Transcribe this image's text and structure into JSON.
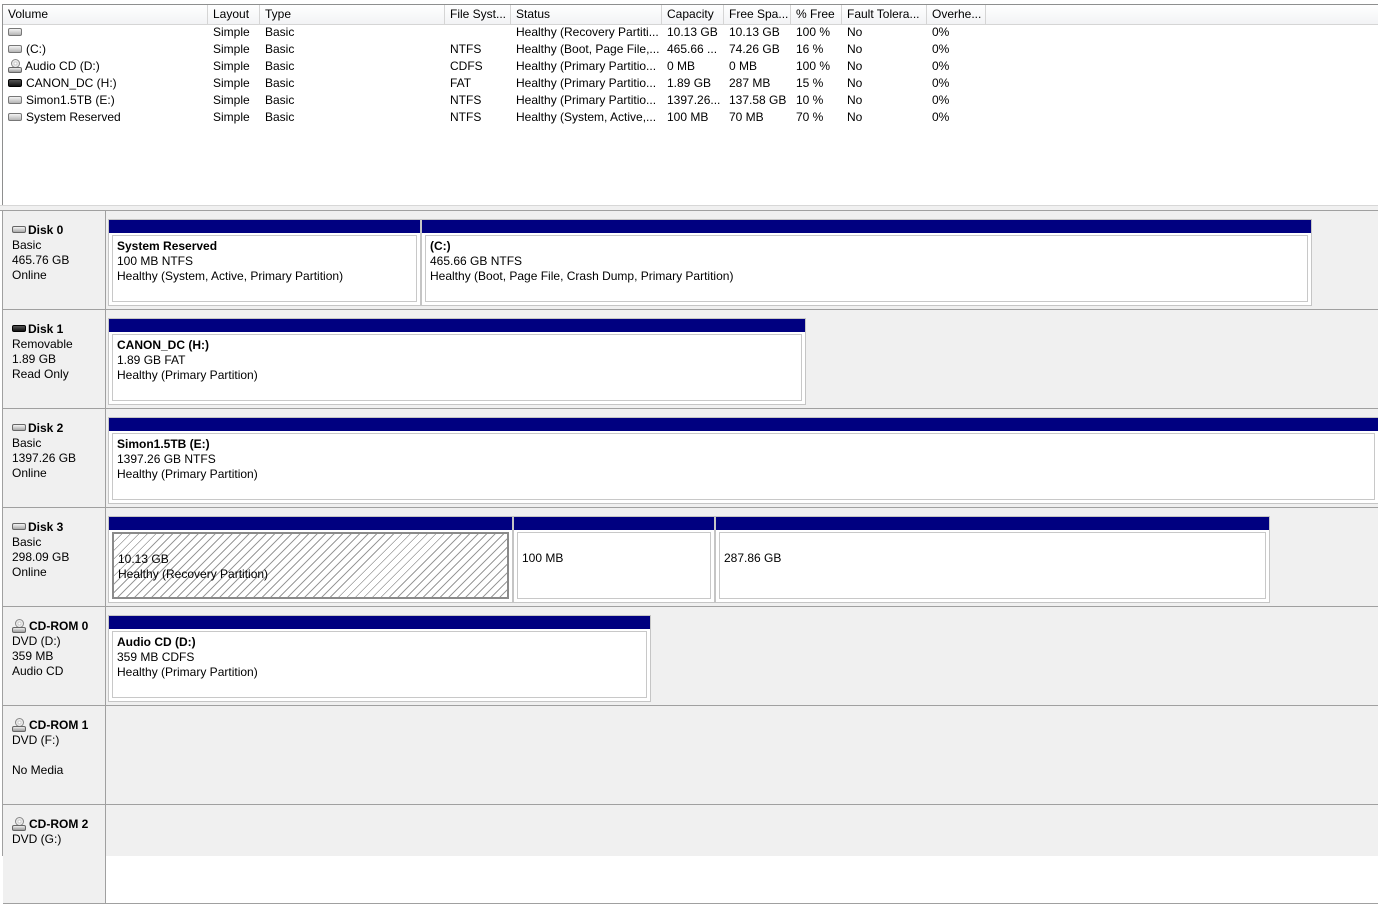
{
  "volume_list": {
    "columns": [
      "Volume",
      "Layout",
      "Type",
      "File Syst...",
      "Status",
      "Capacity",
      "Free Spa...",
      "% Free",
      "Fault Tolera...",
      "Overhe..."
    ],
    "rows": [
      {
        "icon": "drive-icon",
        "volume": "",
        "layout": "Simple",
        "type": "Basic",
        "fs": "",
        "status": "Healthy (Recovery Partiti...",
        "capacity": "10.13 GB",
        "free": "10.13 GB",
        "pct_free": "100 %",
        "fault": "No",
        "overhead": "0%"
      },
      {
        "icon": "drive-icon",
        "volume": "(C:)",
        "layout": "Simple",
        "type": "Basic",
        "fs": "NTFS",
        "status": "Healthy (Boot, Page File,...",
        "capacity": "465.66 ...",
        "free": "74.26 GB",
        "pct_free": "16 %",
        "fault": "No",
        "overhead": "0%"
      },
      {
        "icon": "cd-icon",
        "volume": "Audio CD (D:)",
        "layout": "Simple",
        "type": "Basic",
        "fs": "CDFS",
        "status": "Healthy (Primary Partitio...",
        "capacity": "0 MB",
        "free": "0 MB",
        "pct_free": "100 %",
        "fault": "No",
        "overhead": "0%"
      },
      {
        "icon": "removable-drive-icon",
        "volume": "CANON_DC (H:)",
        "layout": "Simple",
        "type": "Basic",
        "fs": "FAT",
        "status": "Healthy (Primary Partitio...",
        "capacity": "1.89 GB",
        "free": "287 MB",
        "pct_free": "15 %",
        "fault": "No",
        "overhead": "0%"
      },
      {
        "icon": "drive-icon",
        "volume": "Simon1.5TB (E:)",
        "layout": "Simple",
        "type": "Basic",
        "fs": "NTFS",
        "status": "Healthy (Primary Partitio...",
        "capacity": "1397.26...",
        "free": "137.58 GB",
        "pct_free": "10 %",
        "fault": "No",
        "overhead": "0%"
      },
      {
        "icon": "drive-icon",
        "volume": "System Reserved",
        "layout": "Simple",
        "type": "Basic",
        "fs": "NTFS",
        "status": "Healthy (System, Active,...",
        "capacity": "100 MB",
        "free": "70 MB",
        "pct_free": "70 %",
        "fault": "No",
        "overhead": "0%"
      }
    ]
  },
  "disks": [
    {
      "icon": "disk-icon",
      "name": "Disk 0",
      "lines": [
        "Basic",
        "465.76 GB",
        "Online"
      ],
      "partitions": [
        {
          "name": "System Reserved",
          "size": "100 MB NTFS",
          "status": "Healthy (System, Active, Primary Partition)"
        },
        {
          "name": "(C:)",
          "size": "465.66 GB NTFS",
          "status": "Healthy (Boot, Page File, Crash Dump, Primary Partition)"
        }
      ]
    },
    {
      "icon": "removable-disk-icon",
      "name": "Disk 1",
      "lines": [
        "Removable",
        "1.89 GB",
        "Read Only"
      ],
      "partitions": [
        {
          "name": "CANON_DC  (H:)",
          "size": "1.89 GB FAT",
          "status": "Healthy (Primary Partition)"
        }
      ]
    },
    {
      "icon": "disk-icon",
      "name": "Disk 2",
      "lines": [
        "Basic",
        "1397.26 GB",
        "Online"
      ],
      "partitions": [
        {
          "name": "Simon1.5TB  (E:)",
          "size": "1397.26 GB NTFS",
          "status": "Healthy (Primary Partition)"
        }
      ]
    },
    {
      "icon": "disk-icon",
      "name": "Disk 3",
      "lines": [
        "Basic",
        "298.09 GB",
        "Online"
      ],
      "partitions": [
        {
          "name": "",
          "size": "10.13 GB",
          "status": "Healthy (Recovery Partition)",
          "selected": true
        },
        {
          "name": "",
          "size": "100 MB",
          "status": ""
        },
        {
          "name": "",
          "size": "287.86 GB",
          "status": ""
        }
      ]
    },
    {
      "icon": "cdrom-icon",
      "name": "CD-ROM 0",
      "lines": [
        "DVD (D:)",
        "359 MB",
        "Audio CD"
      ],
      "partitions": [
        {
          "name": "Audio CD  (D:)",
          "size": "359 MB CDFS",
          "status": "Healthy (Primary Partition)"
        }
      ]
    },
    {
      "icon": "cdrom-icon",
      "name": "CD-ROM 1",
      "lines": [
        "DVD (F:)",
        "",
        "No Media"
      ],
      "partitions": []
    },
    {
      "icon": "cdrom-icon",
      "name": "CD-ROM 2",
      "lines": [
        "DVD (G:)",
        "",
        ""
      ],
      "partitions": []
    }
  ],
  "colors": {
    "partition_bar": "#000080",
    "panel_bg": "#f0f0f0",
    "border": "#a0a0a0"
  }
}
